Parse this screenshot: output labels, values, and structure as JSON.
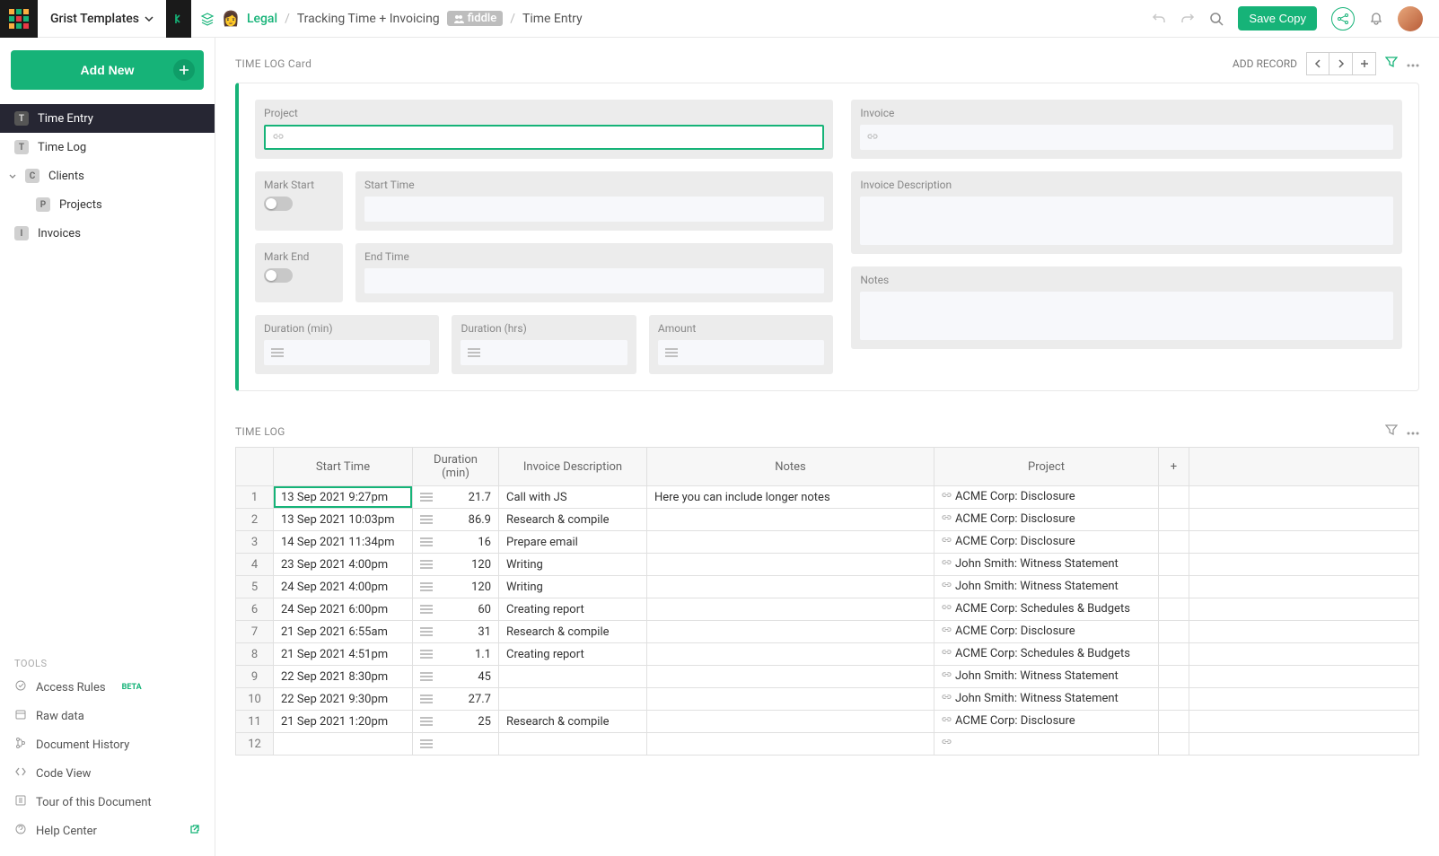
{
  "workspace": "Grist Templates",
  "crumbs": {
    "team": "Legal",
    "doc": "Tracking Time + Invoicing",
    "mode": "fiddle",
    "page": "Time Entry"
  },
  "topbar": {
    "save_copy": "Save Copy"
  },
  "sidebar": {
    "add_new": "Add New",
    "nav": [
      {
        "label": "Time Entry",
        "icon": "T",
        "active": true
      },
      {
        "label": "Time Log",
        "icon": "T"
      },
      {
        "label": "Clients",
        "icon": "C",
        "expandable": true
      },
      {
        "label": "Projects",
        "icon": "P",
        "indent": true
      },
      {
        "label": "Invoices",
        "icon": "I"
      }
    ],
    "tools_header": "TOOLS",
    "tools": [
      {
        "label": "Access Rules",
        "beta": "BETA"
      },
      {
        "label": "Raw data"
      },
      {
        "label": "Document History"
      },
      {
        "label": "Code View"
      },
      {
        "label": "Tour of this Document"
      },
      {
        "label": "Help Center",
        "external": true
      }
    ]
  },
  "card": {
    "title": "TIME LOG Card",
    "add_record": "ADD RECORD",
    "labels": {
      "project": "Project",
      "invoice": "Invoice",
      "mark_start": "Mark Start",
      "start_time": "Start Time",
      "invoice_desc": "Invoice Description",
      "mark_end": "Mark End",
      "end_time": "End Time",
      "duration_min": "Duration (min)",
      "duration_hrs": "Duration (hrs)",
      "amount": "Amount",
      "notes": "Notes"
    }
  },
  "log": {
    "title": "TIME LOG",
    "columns": [
      "Start Time",
      "Duration (min)",
      "Invoice Description",
      "Notes",
      "Project"
    ],
    "add_col": "+",
    "rows": [
      {
        "n": "1",
        "start": "13 Sep 2021 9:27pm",
        "dur": "21.7",
        "desc": "Call with JS",
        "notes": "Here you can include longer notes",
        "project": "ACME Corp: Disclosure"
      },
      {
        "n": "2",
        "start": "13 Sep 2021 10:03pm",
        "dur": "86.9",
        "desc": "Research & compile",
        "notes": "",
        "project": "ACME Corp: Disclosure"
      },
      {
        "n": "3",
        "start": "14 Sep 2021 11:34pm",
        "dur": "16",
        "desc": "Prepare email",
        "notes": "",
        "project": "ACME Corp: Disclosure"
      },
      {
        "n": "4",
        "start": "23 Sep 2021 4:00pm",
        "dur": "120",
        "desc": "Writing",
        "notes": "",
        "project": "John Smith: Witness Statement"
      },
      {
        "n": "5",
        "start": "24 Sep 2021 4:00pm",
        "dur": "120",
        "desc": "Writing",
        "notes": "",
        "project": "John Smith: Witness Statement"
      },
      {
        "n": "6",
        "start": "24 Sep 2021 6:00pm",
        "dur": "60",
        "desc": "Creating report",
        "notes": "",
        "project": "ACME Corp: Schedules & Budgets"
      },
      {
        "n": "7",
        "start": "21 Sep 2021 6:55am",
        "dur": "31",
        "desc": "Research & compile",
        "notes": "",
        "project": "ACME Corp: Disclosure"
      },
      {
        "n": "8",
        "start": "21 Sep 2021 4:51pm",
        "dur": "1.1",
        "desc": "Creating report",
        "notes": "",
        "project": "ACME Corp: Schedules & Budgets"
      },
      {
        "n": "9",
        "start": "22 Sep 2021 8:30pm",
        "dur": "45",
        "desc": "",
        "notes": "",
        "project": "John Smith: Witness Statement"
      },
      {
        "n": "10",
        "start": "22 Sep 2021 9:30pm",
        "dur": "27.7",
        "desc": "",
        "notes": "",
        "project": "John Smith: Witness Statement"
      },
      {
        "n": "11",
        "start": "21 Sep 2021 1:20pm",
        "dur": "25",
        "desc": "Research & compile",
        "notes": "",
        "project": "ACME Corp: Disclosure"
      },
      {
        "n": "12",
        "start": "",
        "dur": "",
        "desc": "",
        "notes": "",
        "project": ""
      }
    ]
  }
}
